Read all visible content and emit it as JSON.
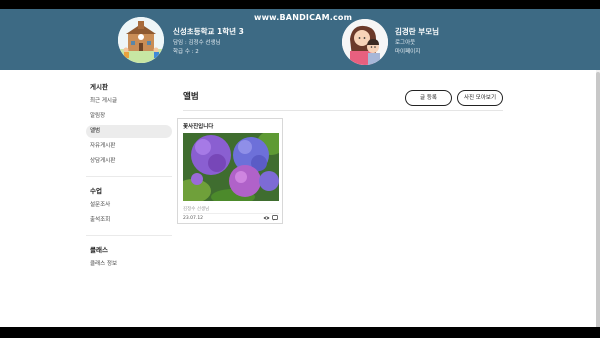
{
  "header": {
    "school": {
      "name": "신성초등학교 1학년 3",
      "teacher": "담임 : 김정수 선생님",
      "student_count": "학급 수 : 2"
    },
    "watermark": "www.BANDICAM.com",
    "parent": {
      "name": "김경란 부모님",
      "child": "로그아웃",
      "mypage": "마이페이지"
    }
  },
  "sidebar": {
    "groups": [
      {
        "title": "게시판",
        "items": [
          {
            "label": "최근 게시글"
          },
          {
            "label": "알림장"
          },
          {
            "label": "앨범"
          },
          {
            "label": "자유게시판"
          },
          {
            "label": "상담게시판"
          }
        ]
      },
      {
        "title": "수업",
        "items": [
          {
            "label": "설문조사"
          },
          {
            "label": "출석조회"
          }
        ]
      },
      {
        "title": "클래스",
        "items": [
          {
            "label": "클래스 정보"
          }
        ]
      }
    ],
    "active_item": "앨범"
  },
  "main": {
    "title": "앨범",
    "buttons": {
      "write": "글 등록",
      "gallery": "사진 모아보기"
    },
    "cards": [
      {
        "title": "꽃사진입니다",
        "author": "김정수 선생님",
        "date": "23.07.12",
        "icons": [
          "eye-icon",
          "comment-icon"
        ]
      }
    ]
  },
  "colors": {
    "header_bg": "#3d6a84",
    "active_bg": "#ececec",
    "accent": "#222222"
  }
}
